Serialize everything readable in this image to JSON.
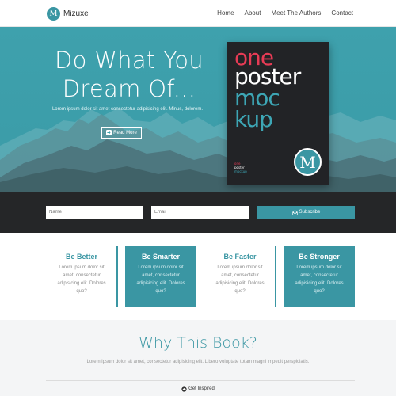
{
  "nav": {
    "brand_initial": "M",
    "brand_name": "Mizuxe",
    "links": [
      "Home",
      "About",
      "Meet The Authors",
      "Contact"
    ]
  },
  "hero": {
    "title": "Do What You Dream Of...",
    "subtitle": "Lorem ipsum dolor sit amet consectetur adipisicing elit. Minus, dolorem.",
    "button_icon": "arrow-right-icon",
    "button_label": "Read More"
  },
  "poster": {
    "lines": [
      "one",
      "poster",
      "moc",
      "kup"
    ],
    "small_lines": [
      "one",
      "poster",
      "mockup"
    ],
    "logo_initial": "M"
  },
  "subscribe": {
    "name_placeholder": "Name",
    "email_placeholder": "Email",
    "button_icon": "envelope-open-icon",
    "button_label": "Subscribe"
  },
  "features": [
    {
      "title": "Be Better",
      "text": "Lorem ipsum dolor sit amet, consectetur adipisicing elit. Dolores quo?"
    },
    {
      "title": "Be Smarter",
      "text": "Lorem ipsum dolor sit amet, consectetur adipisicing elit. Dolores quo?"
    },
    {
      "title": "Be Faster",
      "text": "Lorem ipsum dolor sit amet, consectetur adipisicing elit. Dolores quo?"
    },
    {
      "title": "Be Stronger",
      "text": "Lorem ipsum dolor sit amet, consectetur adipisicing elit. Dolores quo?"
    }
  ],
  "why": {
    "title": "Why This Book?",
    "text": "Lorem ipsum dolor sit amet, consectetur adipisicing elit. Libero voluptate totam magni impedit perspiciatis.",
    "button_icon": "cloud-icon",
    "button_label": "Get Inspired"
  },
  "colors": {
    "accent": "#3a96a3",
    "hero_bg": "#3ea1ad",
    "dark_bar": "#252628",
    "poster_red": "#e63b55",
    "poster_bg": "#222326"
  }
}
